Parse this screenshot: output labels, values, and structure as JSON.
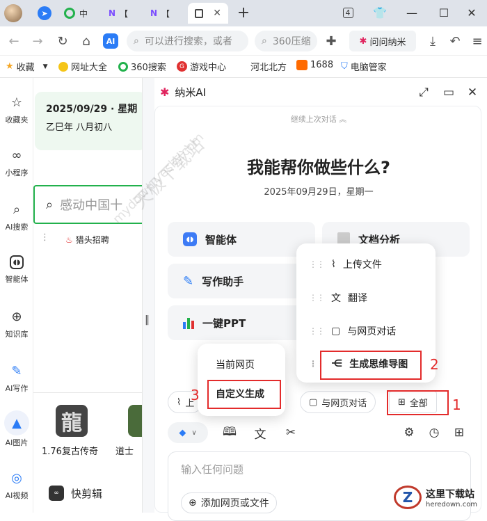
{
  "tabs": [
    {
      "label": "中",
      "icon": "360-browser-icon"
    },
    {
      "label": "【",
      "icon": "nami-icon"
    },
    {
      "label": "【",
      "icon": "nami-icon"
    },
    {
      "label": "",
      "icon": "page-icon",
      "active": true
    }
  ],
  "tab_count": "4",
  "address": {
    "search_placeholder": "可以进行搜索，或者",
    "search2": "360压缩",
    "ai_label": "AI",
    "nami_label": "问问纳米"
  },
  "bookmarks": [
    "收藏",
    "网址大全",
    "360搜索",
    "游戏中心",
    "河北北方",
    "1688",
    "电脑管家"
  ],
  "left_sidebar": [
    {
      "icon": "star-icon",
      "label": "收藏夹"
    },
    {
      "icon": "mini-program-icon",
      "label": "小程序"
    },
    {
      "icon": "ai-search-icon",
      "label": "AI搜索"
    },
    {
      "icon": "agent-icon",
      "label": "智能体"
    },
    {
      "icon": "knowledge-base-icon",
      "label": "知识库"
    },
    {
      "icon": "ai-write-icon",
      "label": "AI写作"
    },
    {
      "icon": "ai-image-icon",
      "label": "AI图片"
    },
    {
      "icon": "ai-video-icon",
      "label": "AI视频"
    }
  ],
  "page": {
    "date": "2025/09/29 · 星期",
    "lunar": "乙巳年 八月初八",
    "search_text": "感动中国十",
    "recruit": "猎头招聘",
    "game1": "1.76复古传奇",
    "game2": "道士",
    "app": "快剪辑"
  },
  "panel": {
    "title": "纳米AI",
    "continue": "继续上次对话",
    "heading": "我能帮你做些什么?",
    "date": "2025年09月29日，星期一",
    "cards": [
      "智能体",
      "文档分析",
      "写作助手",
      "一键PPT"
    ],
    "menu_all": [
      "上传文件",
      "翻译",
      "与网页对话",
      "生成思维导图"
    ],
    "menu_mindmap": [
      "当前网页",
      "自定义生成"
    ],
    "pill_upload": "上",
    "pill_webchat": "与网页对话",
    "pill_all": "全部",
    "input_placeholder": "输入任何问题",
    "add_file": "添加网页或文件"
  },
  "annotations": [
    "1",
    "2",
    "3"
  ],
  "watermark": [
    "天极下载站",
    "mydown.yesky.com"
  ],
  "corner_logo": "这里下载站",
  "corner_url": "heredown.com",
  "colors": {
    "accent_green": "#22b14c",
    "annotation_red": "#e32b2b",
    "nami_red": "#e0245e"
  }
}
